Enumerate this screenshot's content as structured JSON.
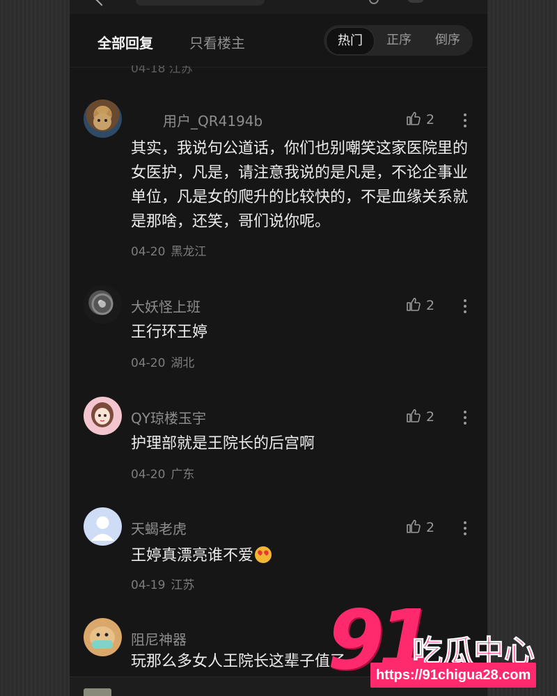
{
  "tabs": {
    "all_replies": "全部回复",
    "op_only": "只看楼主"
  },
  "sort": {
    "hot": "热门",
    "ascending": "正序",
    "descending": "倒序"
  },
  "partial_meta": "04-18 江苏",
  "comments": [
    {
      "username": "用户_QR4194b",
      "likes": "2",
      "text": "其实，我说句公道话，你们也别嘲笑这家医院里的女医护，凡是，请注意我说的是凡是，不论企事业单位，凡是女的爬升的比较快的，不是血缘关系就是那啥，还笑，哥们说你呢。",
      "date": "04-20",
      "location": "黑龙江",
      "avatar_icon": "cat-photo-avatar"
    },
    {
      "username": "大妖怪上班",
      "likes": "2",
      "text": "王行环王婷",
      "date": "04-20",
      "location": "湖北",
      "avatar_icon": "dark-object-avatar"
    },
    {
      "username": "QY琼楼玉宇",
      "likes": "2",
      "text": "护理部就是王院长的后宫啊",
      "date": "04-20",
      "location": "广东",
      "avatar_icon": "anime-girl-avatar"
    },
    {
      "username": "天蝎老虎",
      "likes": "2",
      "text": "王婷真漂亮谁不爱",
      "emoji": "heart-eyes-emoji",
      "date": "04-19",
      "location": "江苏",
      "avatar_icon": "default-person-avatar"
    },
    {
      "username": "阻尼神器",
      "text": "玩那么多女人王院长这辈子值了",
      "avatar_icon": "masked-dog-avatar"
    }
  ],
  "watermark": {
    "number": "91",
    "name": "吃瓜中心",
    "url": "https://91chigua28.com"
  },
  "colors": {
    "accent": "#ff2a6d",
    "background": "#161616"
  }
}
